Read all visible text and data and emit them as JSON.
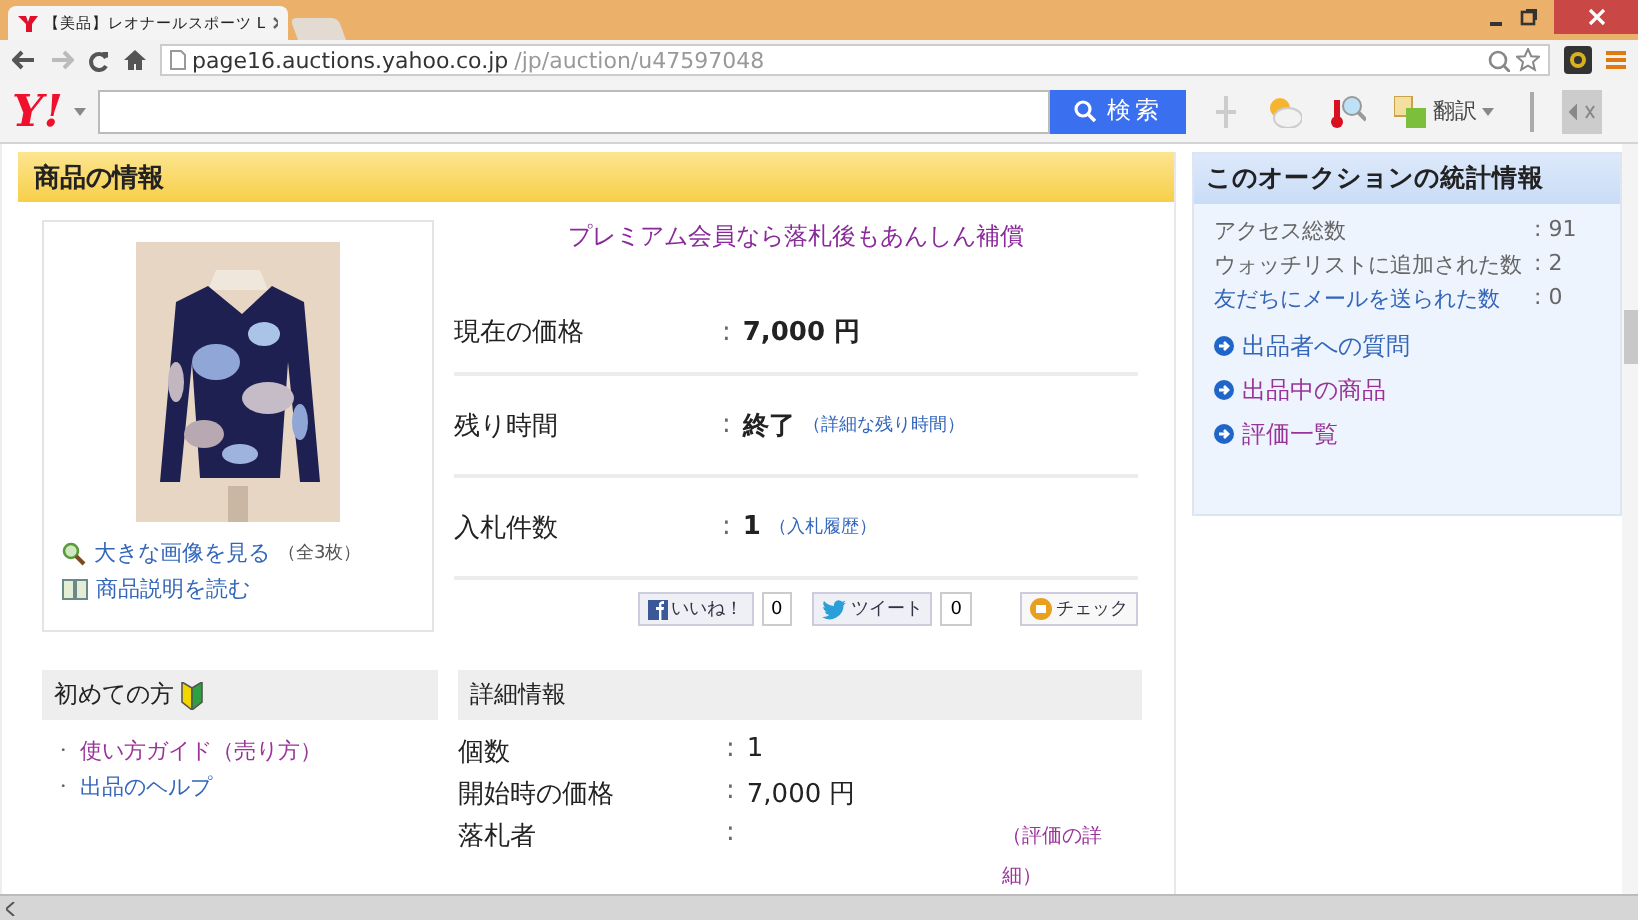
{
  "browser": {
    "tab_title": "【美品】レオナールスポーツ L",
    "address_host": "page16.auctions.yahoo.co.jp",
    "address_path": "/jp/auction/u47597048"
  },
  "toolbar": {
    "logo": "Y!",
    "search_button": "検索",
    "translate": "翻訳"
  },
  "item_section": {
    "title": "商品の情報",
    "image_links": [
      {
        "label": "大きな画像を見る",
        "note": "（全3枚）"
      },
      {
        "label": "商品説明を読む"
      }
    ],
    "promo": "プレミアム会員なら落札後もあんしん補償",
    "rows": [
      {
        "label": "現在の価格",
        "sep": ":",
        "value": "7,000 円"
      },
      {
        "label": "残り時間",
        "sep": ":",
        "value": "終了",
        "link": "（詳細な残り時間）"
      },
      {
        "label": "入札件数",
        "sep": ":",
        "value": "1",
        "link": "（入札履歴）"
      }
    ],
    "social": {
      "like": "いいね！",
      "like_count": "0",
      "tweet": "ツイート",
      "tweet_count": "0",
      "check": "チェック"
    }
  },
  "beginner": {
    "title": "初めての方",
    "links": [
      {
        "bullet": "・",
        "label": "使い方ガイド（売り方）",
        "visited": true
      },
      {
        "bullet": "・",
        "label": "出品のヘルプ",
        "visited": false
      }
    ]
  },
  "details": {
    "title": "詳細情報",
    "rows": [
      {
        "label": "個数",
        "sep": ":",
        "value": "1"
      },
      {
        "label": "開始時の価格",
        "sep": ":",
        "value": "7,000 円"
      },
      {
        "label": "落札者",
        "sep": ":",
        "link": "（評価の詳細）"
      }
    ]
  },
  "stats": {
    "title": "このオークションの統計情報",
    "rows": [
      {
        "label": "アクセス総数",
        "value": ": 91",
        "kind": "text"
      },
      {
        "label": "ウォッチリストに追加された数",
        "value": ": 2",
        "kind": "text"
      },
      {
        "label": "友だちにメールを送られた数",
        "value": ": 0",
        "kind": "link"
      }
    ],
    "links": [
      {
        "label": "出品者への質問",
        "visited": false
      },
      {
        "label": "出品中の商品",
        "visited": true
      },
      {
        "label": "評価一覧",
        "visited": true
      }
    ]
  }
}
